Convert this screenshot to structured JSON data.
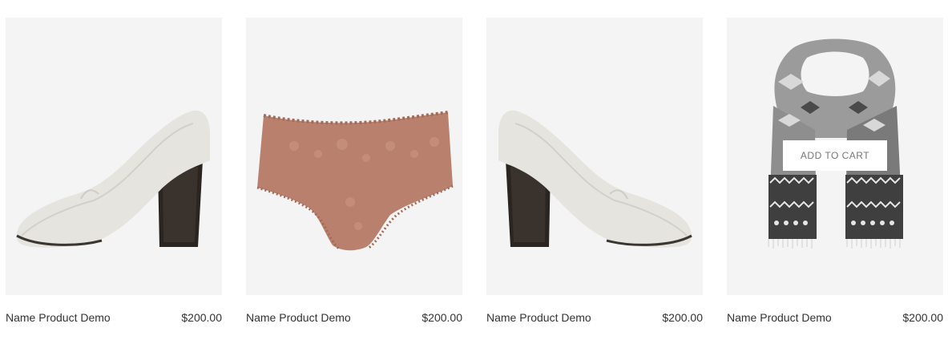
{
  "products": [
    {
      "name": "Name Product Demo",
      "price": "$200.00",
      "image_icon": "white-heel-shoe-image"
    },
    {
      "name": "Name Product Demo",
      "price": "$200.00",
      "image_icon": "lace-underwear-image"
    },
    {
      "name": "Name Product Demo",
      "price": "$200.00",
      "image_icon": "white-heel-shoe-image"
    },
    {
      "name": "Name Product Demo",
      "price": "$200.00",
      "image_icon": "patterned-scarf-image",
      "hover_button": "ADD TO CART"
    }
  ],
  "colors": {
    "thumb_bg": "#f4f4f4",
    "text": "#333333",
    "button_text": "#777777"
  }
}
